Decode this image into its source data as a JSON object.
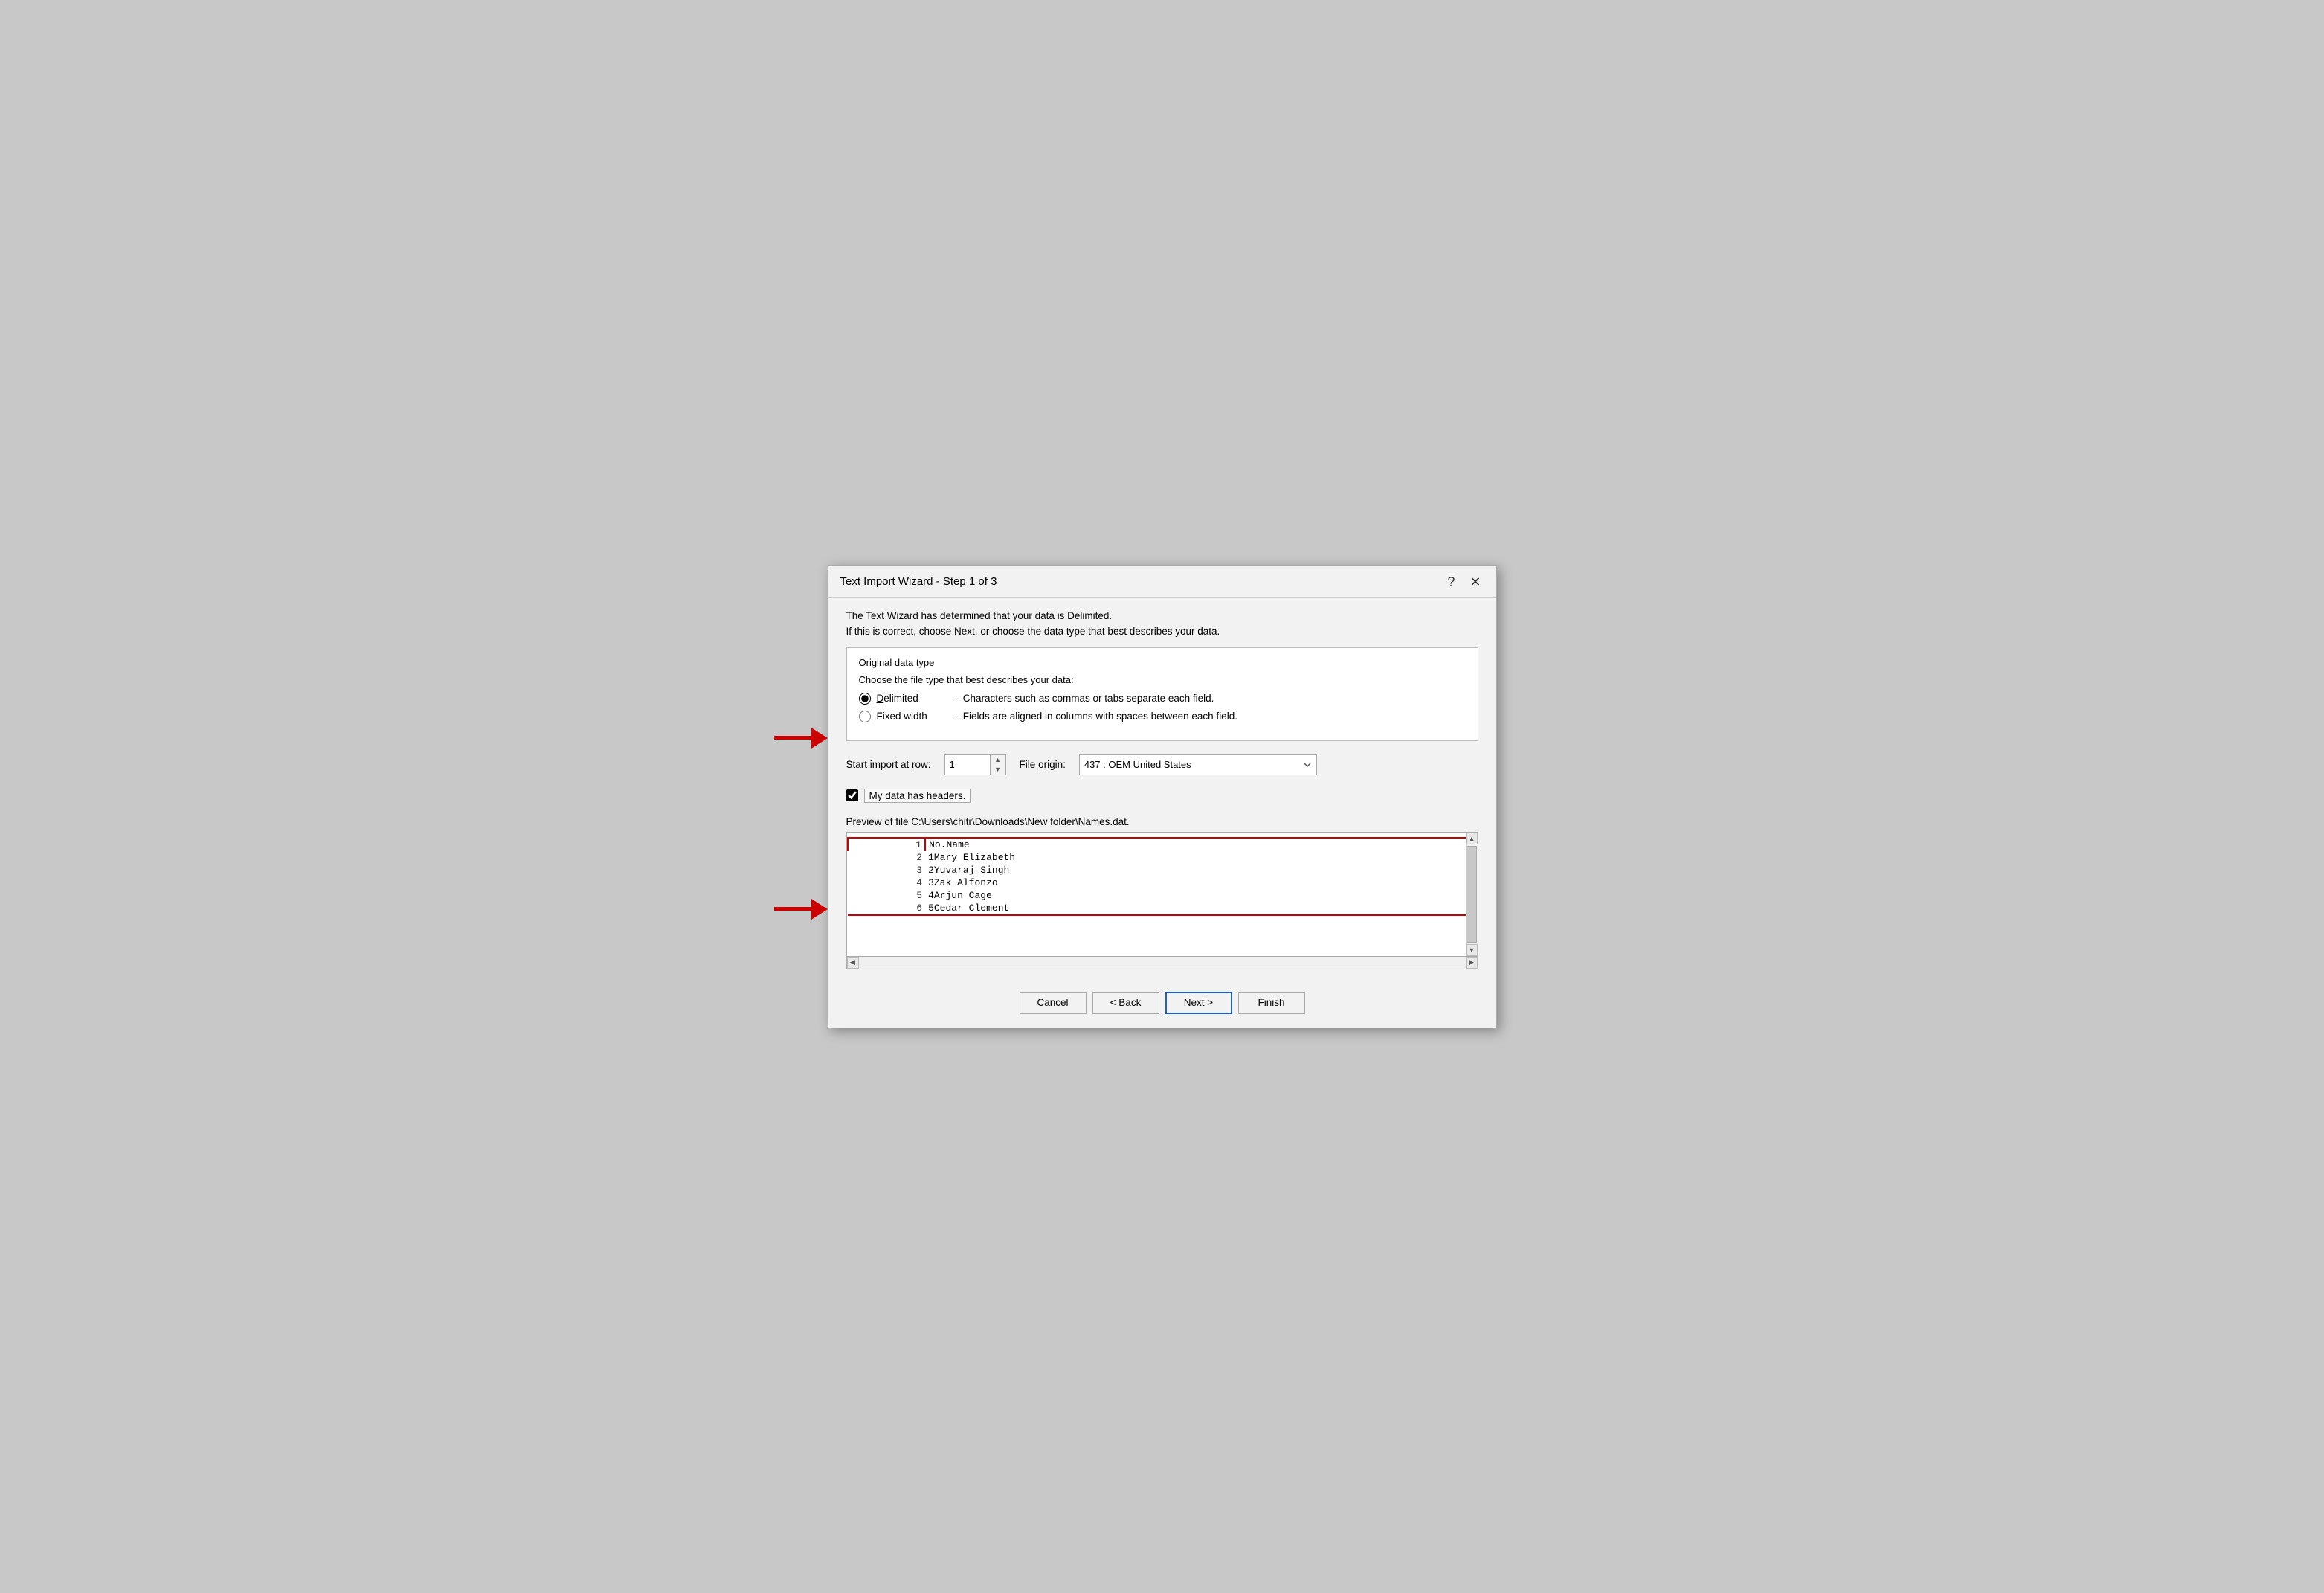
{
  "dialog": {
    "title": "Text Import Wizard - Step 1 of 3",
    "help_btn": "?",
    "close_btn": "✕",
    "intro1": "The Text Wizard has determined that your data is Delimited.",
    "intro2": "If this is correct, choose Next, or choose the data type that best describes your data.",
    "section_title": "Original data type",
    "section_subtitle": "Choose the file type that best describes your data:",
    "radio_delimited_label": "Delimited",
    "radio_delimited_desc": "- Characters such as commas or tabs separate each field.",
    "radio_fixed_label": "Fixed width",
    "radio_fixed_desc": "- Fields are aligned in columns with spaces between each field.",
    "start_row_label": "Start import at row:",
    "start_row_value": "1",
    "file_origin_label": "File origin:",
    "file_origin_value": "437 : OEM United States",
    "checkbox_label": "My data has headers.",
    "preview_label": "Preview of file C:\\Users\\chitr\\Downloads\\New folder\\Names.dat.",
    "preview_rows": [
      {
        "num": "1",
        "content": "No.Name"
      },
      {
        "num": "2",
        "content": "1Mary Elizabeth"
      },
      {
        "num": "3",
        "content": "2Yuvaraj Singh"
      },
      {
        "num": "4",
        "content": "3Zak Alfonzo"
      },
      {
        "num": "5",
        "content": "4Arjun Cage"
      },
      {
        "num": "6",
        "content": "5Cedar Clement"
      }
    ],
    "btn_cancel": "Cancel",
    "btn_back": "< Back",
    "btn_next": "Next >",
    "btn_finish": "Finish"
  }
}
